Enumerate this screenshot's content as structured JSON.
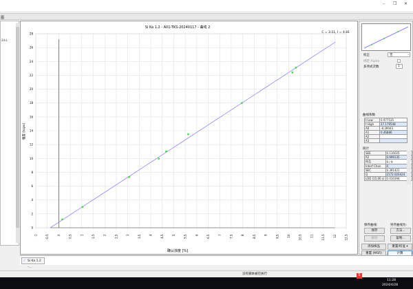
{
  "window": {
    "minimize": "–",
    "restore": "❐",
    "close": "✕",
    "menu_left": "图"
  },
  "left_panel": {
    "text1": "24-L"
  },
  "chart_data": {
    "type": "scatter",
    "title": "Si Ka 1.2 - A01-TKS-20240117 - 曲线 2",
    "annotation": "C = 3.11, I = 4.81",
    "xlabel": "确认浓度 [%]",
    "ylabel": "强度 [kcps]",
    "xlim": [
      -1,
      12.5
    ],
    "ylim": [
      0,
      28
    ],
    "xticks": [
      "-1",
      "-0.5",
      "0",
      "0.5",
      "1",
      "1.5",
      "2",
      "2.5",
      "3",
      "3.5",
      "4",
      "4.5",
      "5",
      "5.5",
      "6",
      "6.5",
      "7",
      "7.5",
      "8",
      "8.5",
      "9",
      "9.5",
      "10",
      "10.5",
      "11",
      "11.5",
      "12",
      "12.5"
    ],
    "yticks": [
      "0",
      "2",
      "4",
      "6",
      "8",
      "10",
      "12",
      "14",
      "16",
      "18",
      "20",
      "22",
      "24",
      "26",
      "28"
    ],
    "grid": true,
    "points": [
      {
        "x": 0.15,
        "y": 1.2
      },
      {
        "x": 1.03,
        "y": 3.0
      },
      {
        "x": 3.06,
        "y": 7.33
      },
      {
        "x": 4.35,
        "y": 9.97
      },
      {
        "x": 4.67,
        "y": 11.0
      },
      {
        "x": 5.63,
        "y": 13.5
      },
      {
        "x": 7.96,
        "y": 18.0
      },
      {
        "x": 10.16,
        "y": 22.4
      },
      {
        "x": 10.31,
        "y": 23.1
      }
    ],
    "fit_line": {
      "x": [
        -0.37,
        12.03
      ],
      "y": [
        0,
        26.8
      ]
    },
    "point_color": "#33dd33",
    "line_color": "#8888ff"
  },
  "right_panel": {
    "correction_label": "校正",
    "correction_value": "无",
    "alpha_label": "绑定 Alpha",
    "poly_label": "多项式次数",
    "poly_value": "1",
    "coef_title": "曲线系数",
    "coefs": [
      {
        "k": "t Low",
        "v": "0.977535"
      },
      {
        "k": "t High",
        "v": "27.179548"
      },
      {
        "k": "A0",
        "v": "-8.39943"
      },
      {
        "k": "A1",
        "v": "0.46886"
      },
      {
        "k": "A2",
        "v": ""
      },
      {
        "k": "A3",
        "v": ""
      }
    ],
    "stats_title": "统计",
    "stats": [
      {
        "k": "SEE",
        "v": "0.116025"
      },
      {
        "k": "R2",
        "v": "0.999135"
      },
      {
        "k": "样品",
        "v": "9 / 9"
      },
      {
        "k": "Interf Chan",
        "v": "0"
      },
      {
        "k": "SEC",
        "v": "0.391421"
      },
      {
        "k": "Q",
        "v": "2172.020424"
      },
      {
        "k": "LOD (15.00 s)",
        "v": "0.010394"
      }
    ],
    "save_curve_label": "保存曲线:",
    "save_as_label": "另存曲线为:",
    "save": "保存",
    "method": "方法...",
    "delete": "删除",
    "copy": "复制...",
    "add_sample": "添加样品",
    "reset_calib": "重置/校准 ▾",
    "reset": "重置 (MSR)",
    "calc": "计算"
  },
  "tab": {
    "label": "Si Ka 1.2 -..."
  },
  "status": {
    "text": "没有脚本被在执行"
  },
  "taskbar": {
    "time": "11:28",
    "date": "2024/4/28"
  }
}
